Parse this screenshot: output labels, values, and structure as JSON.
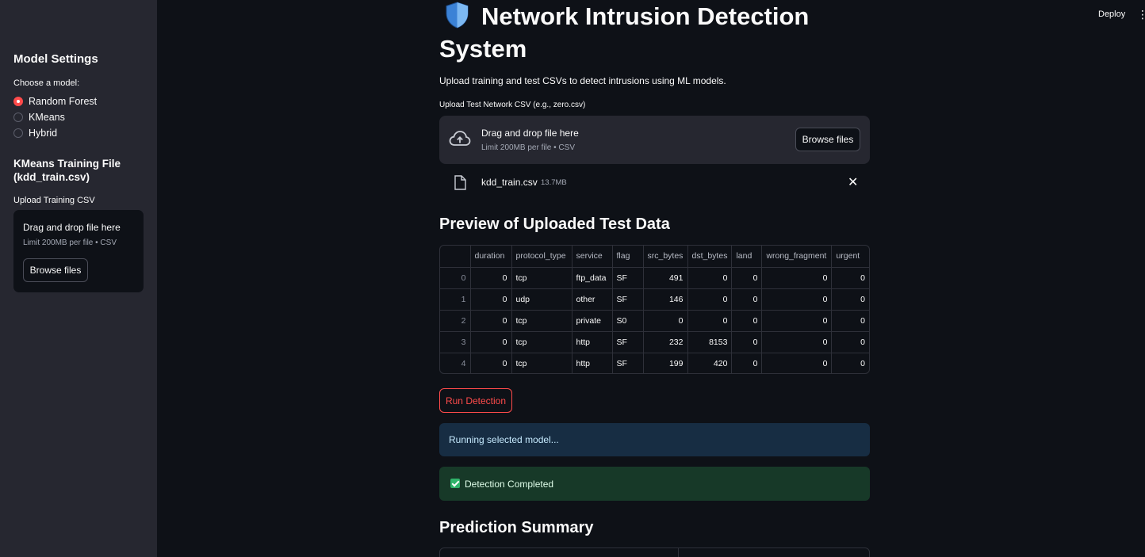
{
  "sidebar": {
    "title": "Model Settings",
    "model_label": "Choose a model:",
    "models": [
      {
        "label": "Random Forest",
        "selected": true
      },
      {
        "label": "KMeans",
        "selected": false
      },
      {
        "label": "Hybrid",
        "selected": false
      }
    ],
    "section_title": "KMeans Training File (kdd_train.csv)",
    "upload_label": "Upload Training CSV",
    "dropzone_text": "Drag and drop file here",
    "dropzone_limit": "Limit 200MB per file • CSV",
    "browse_label": "Browse files"
  },
  "header": {
    "deploy_label": "Deploy",
    "menu_icon": "⋮"
  },
  "main": {
    "title_icon": "shield-icon",
    "title": "Network Intrusion Detection System",
    "subtitle": "Upload training and test CSVs to detect intrusions using ML models.",
    "upload_label": "Upload Test Network CSV (e.g., zero.csv)",
    "dropzone_text": "Drag and drop file here",
    "dropzone_limit": "Limit 200MB per file • CSV",
    "browse_label": "Browse files",
    "uploaded_file": {
      "name": "kdd_train.csv",
      "size": "13.7MB"
    },
    "preview_heading": "Preview of Uploaded Test Data",
    "table": {
      "columns": [
        "",
        "duration",
        "protocol_type",
        "service",
        "flag",
        "src_bytes",
        "dst_bytes",
        "land",
        "wrong_fragment",
        "urgent"
      ],
      "rows": [
        [
          "0",
          "0",
          "tcp",
          "ftp_data",
          "SF",
          "491",
          "0",
          "0",
          "0",
          "0"
        ],
        [
          "1",
          "0",
          "udp",
          "other",
          "SF",
          "146",
          "0",
          "0",
          "0",
          "0"
        ],
        [
          "2",
          "0",
          "tcp",
          "private",
          "S0",
          "0",
          "0",
          "0",
          "0",
          "0"
        ],
        [
          "3",
          "0",
          "tcp",
          "http",
          "SF",
          "232",
          "8153",
          "0",
          "0",
          "0"
        ],
        [
          "4",
          "0",
          "tcp",
          "http",
          "SF",
          "199",
          "420",
          "0",
          "0",
          "0"
        ]
      ]
    },
    "run_button": "Run Detection",
    "info_message": "Running selected model...",
    "success_message": "Detection Completed",
    "summary_heading": "Prediction Summary"
  },
  "colors": {
    "background": "#0e1117",
    "sidebar": "#262730",
    "accent": "#ff4b4b",
    "info_bg": "#172d43",
    "success_bg": "#173928"
  }
}
